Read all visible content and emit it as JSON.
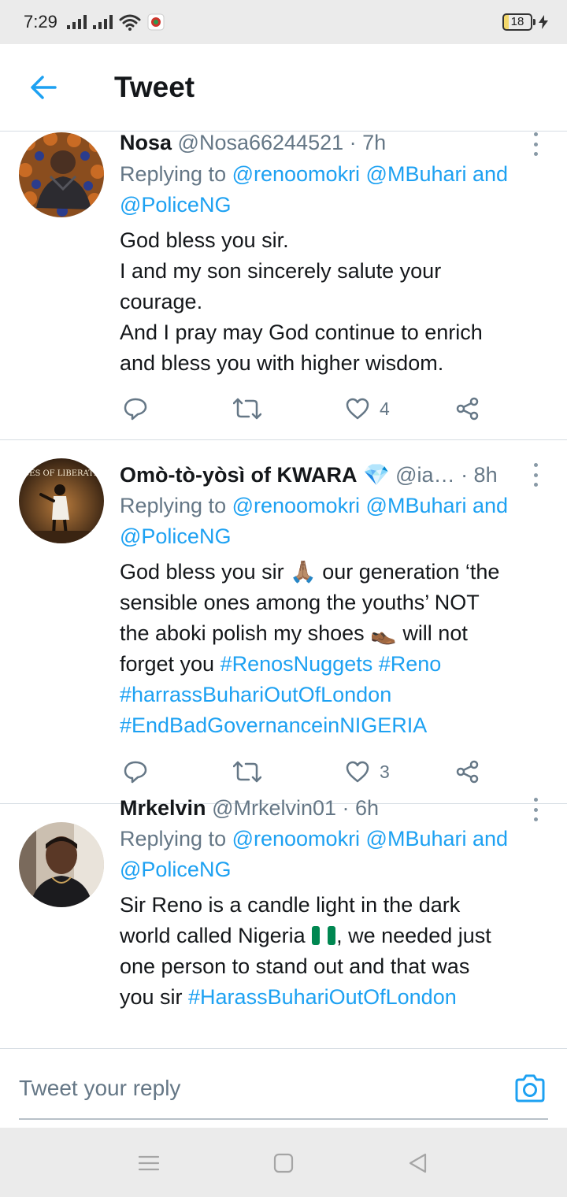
{
  "status_bar": {
    "time": "7:29",
    "battery": "18"
  },
  "header": {
    "title": "Tweet"
  },
  "tweets": [
    {
      "name": "Nosa",
      "meta": "@Nosa66244521 · 7h",
      "replying_prefix": "Replying to ",
      "replying_to_main": "@renoomokri @MBuhari and",
      "replying_to_second": "@PoliceNG",
      "body_lines": [
        "God bless you sir.",
        "I and my son sincerely salute your",
        "courage.",
        "And I pray may God continue to enrich",
        "and bless you with higher wisdom."
      ],
      "likes": "4"
    },
    {
      "name": "Omò-tò-yòsì of KWARA",
      "badge": "💎",
      "meta": "@ia… · 8h",
      "avatar_text": "FACES OF LIBERATION",
      "replying_prefix": "Replying to ",
      "replying_to_main": "@renoomokri @MBuhari and",
      "replying_to_second": "@PoliceNG",
      "body_line1": "God bless you sir ",
      "emoji_pray": "🙏🏽",
      "body_line1b": " our generation ‘the",
      "body_line2": "sensible ones among the youths’ NOT",
      "body_line3a": "the aboki polish my shoes ",
      "emoji_shoe": "👞",
      "body_line3b": " will not",
      "body_line4": "forget you  ",
      "hashtag1": "#RenosNuggets",
      "hashtag2": "#Reno",
      "hashtag3": "#harrassBuhariOutOfLondon",
      "hashtag4": "#EndBadGovernanceinNIGERIA",
      "likes": "3"
    },
    {
      "name": "Mrkelvin",
      "meta": "@Mrkelvin01 · 6h",
      "replying_prefix": "Replying to ",
      "replying_to_main": "@renoomokri @MBuhari and",
      "replying_to_second": "@PoliceNG",
      "body_line1": "Sir Reno is a candle light in the dark",
      "body_line2a": "world called Nigeria ",
      "body_line2b": ", we needed just",
      "body_line3": "one person to stand out and that was",
      "body_line4a": "you sir ",
      "hashtag": "#HarassBuhariOutOfLondon"
    }
  ],
  "reply_box": {
    "placeholder": "Tweet your reply"
  },
  "colors": {
    "accent": "#1da1f2",
    "text": "#14171a",
    "muted": "#657786",
    "divider": "#d6dde3",
    "system_bar": "#ebebeb"
  }
}
